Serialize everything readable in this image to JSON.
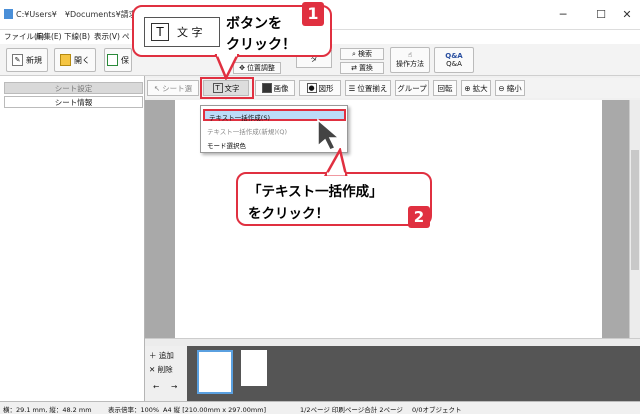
{
  "window": {
    "title": "C:¥Users¥　¥Documents¥請求書.kii * ⌐",
    "minimize": "─",
    "maximize": "☐",
    "close": "✕"
  },
  "menubar": {
    "items": [
      "ファイル(F)",
      "編集(E)",
      "下線(B)",
      "表示(V)",
      "ペ"
    ]
  },
  "toolbar": {
    "new_label": "新規",
    "open_label": "開く",
    "save_label": "保",
    "position_adjust": "位置調整",
    "search": "検索",
    "replace": "置換",
    "help": "操作方法",
    "qa": "Q&A",
    "ta_partial": "タ"
  },
  "sidebar": {
    "tabs": [
      "シート設定",
      "シート情報"
    ]
  },
  "toolbar2": {
    "items": [
      "シート選",
      "文字",
      "画像",
      "図形",
      "位置揃え",
      "グループ",
      "回転",
      "拡大",
      "縮小"
    ]
  },
  "dropdown": {
    "items": [
      "テキスト一括作成(S)",
      "テキスト一括作成(新規)(Q)",
      "モード選択色"
    ]
  },
  "bottom": {
    "add": "追加",
    "delete": "削除",
    "prev": "←",
    "next": "→"
  },
  "statusbar": {
    "coords": "横：29.1 mm, 縦：48.2 mm",
    "zoom": "表示倍率：100%",
    "paper": "A4 縦 [210.00mm x 297.00mm]",
    "pages": "1/2ページ 印刷ページ合計 2ページ",
    "objects": "0/0オブジェクト"
  },
  "callouts": {
    "step1_icon_t": "T",
    "step1_icon_text": "文 字",
    "step1_line1": "ボタンを",
    "step1_line2": "クリック！",
    "step1_num": "1",
    "step2_line1": "「テキスト一括作成」",
    "step2_line2": "をクリック！",
    "step2_num": "2"
  },
  "colors": {
    "accent_red": "#e03040",
    "selection_blue": "#bcdcf8"
  }
}
